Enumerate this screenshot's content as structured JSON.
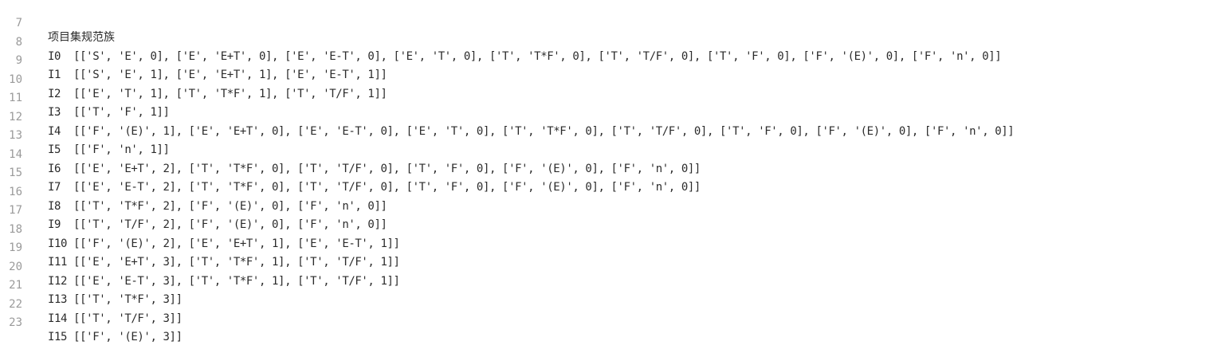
{
  "editor": {
    "lines": [
      {
        "number": "7",
        "text": "项目集规范族"
      },
      {
        "number": "8",
        "text": "I0  [['S', 'E', 0], ['E', 'E+T', 0], ['E', 'E-T', 0], ['E', 'T', 0], ['T', 'T*F', 0], ['T', 'T/F', 0], ['T', 'F', 0], ['F', '(E)', 0], ['F', 'n', 0]]"
      },
      {
        "number": "9",
        "text": "I1  [['S', 'E', 1], ['E', 'E+T', 1], ['E', 'E-T', 1]]"
      },
      {
        "number": "10",
        "text": "I2  [['E', 'T', 1], ['T', 'T*F', 1], ['T', 'T/F', 1]]"
      },
      {
        "number": "11",
        "text": "I3  [['T', 'F', 1]]"
      },
      {
        "number": "12",
        "text": "I4  [['F', '(E)', 1], ['E', 'E+T', 0], ['E', 'E-T', 0], ['E', 'T', 0], ['T', 'T*F', 0], ['T', 'T/F', 0], ['T', 'F', 0], ['F', '(E)', 0], ['F', 'n', 0]]"
      },
      {
        "number": "13",
        "text": "I5  [['F', 'n', 1]]"
      },
      {
        "number": "14",
        "text": "I6  [['E', 'E+T', 2], ['T', 'T*F', 0], ['T', 'T/F', 0], ['T', 'F', 0], ['F', '(E)', 0], ['F', 'n', 0]]"
      },
      {
        "number": "15",
        "text": "I7  [['E', 'E-T', 2], ['T', 'T*F', 0], ['T', 'T/F', 0], ['T', 'F', 0], ['F', '(E)', 0], ['F', 'n', 0]]"
      },
      {
        "number": "16",
        "text": "I8  [['T', 'T*F', 2], ['F', '(E)', 0], ['F', 'n', 0]]"
      },
      {
        "number": "17",
        "text": "I9  [['T', 'T/F', 2], ['F', '(E)', 0], ['F', 'n', 0]]"
      },
      {
        "number": "18",
        "text": "I10 [['F', '(E)', 2], ['E', 'E+T', 1], ['E', 'E-T', 1]]"
      },
      {
        "number": "19",
        "text": "I11 [['E', 'E+T', 3], ['T', 'T*F', 1], ['T', 'T/F', 1]]"
      },
      {
        "number": "20",
        "text": "I12 [['E', 'E-T', 3], ['T', 'T*F', 1], ['T', 'T/F', 1]]"
      },
      {
        "number": "21",
        "text": "I13 [['T', 'T*F', 3]]"
      },
      {
        "number": "22",
        "text": "I14 [['T', 'T/F', 3]]"
      },
      {
        "number": "23",
        "text": "I15 [['F', '(E)', 3]]"
      }
    ]
  }
}
